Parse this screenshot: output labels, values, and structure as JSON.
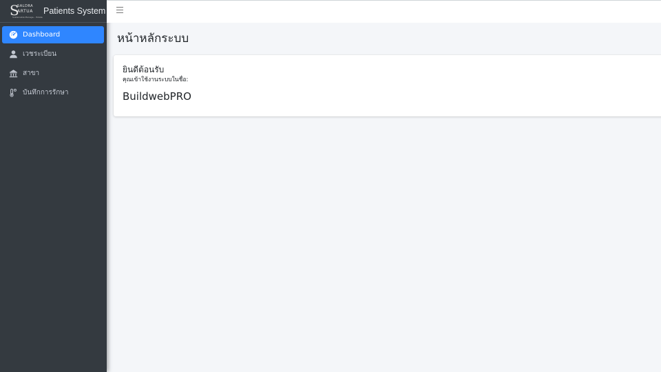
{
  "brand": {
    "logo_line1": "SALDRA",
    "logo_line2": "ARTUA",
    "logo_line3": "Sustainable Manage... Estate",
    "title": "Patients System"
  },
  "sidebar": {
    "items": [
      {
        "label": "Dashboard",
        "icon": "gauge-icon",
        "active": true
      },
      {
        "label": "เวชระเบียน",
        "icon": "user-icon",
        "active": false
      },
      {
        "label": "สาขา",
        "icon": "building-icon",
        "active": false
      },
      {
        "label": "บันทึกการรักษา",
        "icon": "thermometer-icon",
        "active": false
      }
    ]
  },
  "topbar": {
    "menu_icon": "hamburger-icon"
  },
  "main": {
    "page_title": "หน้าหลักระบบ",
    "card": {
      "welcome": "ยินดีต้อนรับ",
      "login_as": "คุณเข้าใช้งานระบบในชื่อ:",
      "username": "BuildwebPRO"
    }
  },
  "colors": {
    "sidebar_bg": "#343a40",
    "active_item": "#2f86ff",
    "content_bg": "#f4f6f9"
  }
}
